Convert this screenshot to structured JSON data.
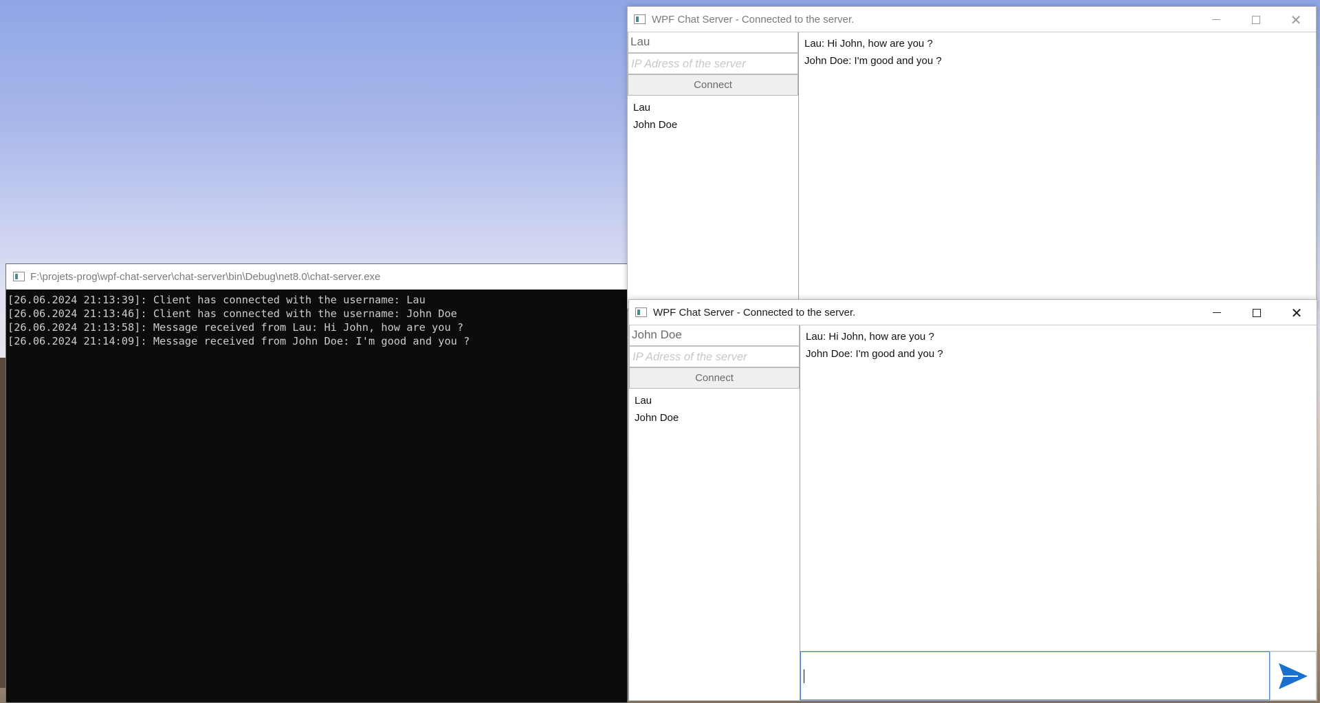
{
  "console": {
    "title": "F:\\projets-prog\\wpf-chat-server\\chat-server\\bin\\Debug\\net8.0\\chat-server.exe",
    "lines": [
      "[26.06.2024 21:13:39]: Client has connected with the username: Lau",
      "[26.06.2024 21:13:46]: Client has connected with the username: John Doe",
      "[26.06.2024 21:13:58]: Message received from Lau: Hi John, how are you ?",
      "[26.06.2024 21:14:09]: Message received from John Doe: I'm good and you ?"
    ]
  },
  "chat_window_1": {
    "title": "WPF Chat Server - Connected to the server.",
    "username": "Lau",
    "ip_placeholder": "IP Adress of the server",
    "connect_label": "Connect",
    "users": [
      "Lau",
      "John Doe"
    ],
    "messages": [
      "Lau: Hi John, how are you ?",
      "John Doe: I'm good and you ?"
    ]
  },
  "chat_window_2": {
    "title": "WPF Chat Server - Connected to the server.",
    "username": "John Doe",
    "ip_placeholder": "IP Adress of the server",
    "connect_label": "Connect",
    "users": [
      "Lau",
      "John Doe"
    ],
    "messages": [
      "Lau: Hi John, how are you ?",
      "John Doe: I'm good and you ?"
    ],
    "message_input_value": ""
  },
  "window_controls": {
    "minimize_icon": "minimize-icon",
    "maximize_icon": "maximize-icon",
    "close_icon": "close-icon"
  },
  "colors": {
    "send_icon": "#1a6fd0",
    "console_bg": "#0c0c0c",
    "console_text": "#cccccc",
    "input_focus_border": "#4a7fc1"
  }
}
